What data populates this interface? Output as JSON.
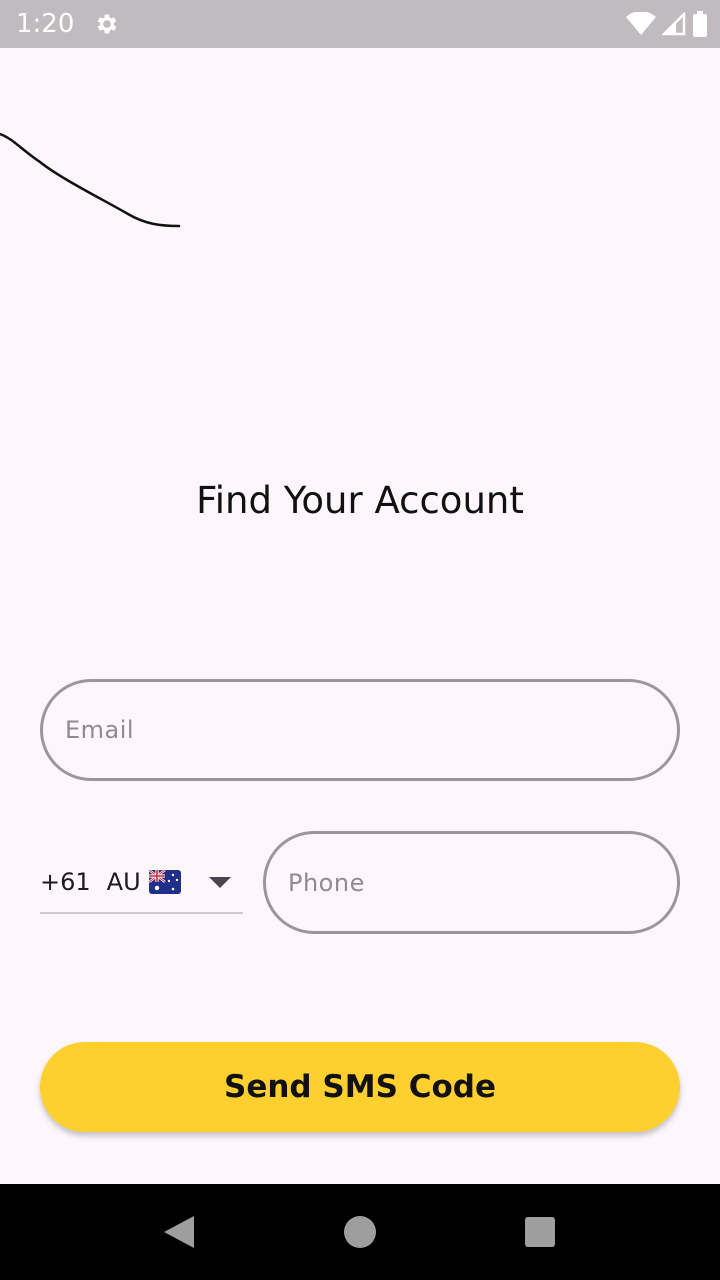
{
  "status_bar": {
    "time": "1:20",
    "icons": [
      "settings-gear-icon",
      "wifi-icon",
      "cellular-signal-icon",
      "battery-icon"
    ]
  },
  "header": {
    "title": "Find Your Account"
  },
  "form": {
    "email": {
      "value": "",
      "placeholder": "Email"
    },
    "country": {
      "dial_code": "+61",
      "iso": "AU",
      "flag_icon": "australia-flag-icon"
    },
    "phone": {
      "value": "",
      "placeholder": "Phone"
    }
  },
  "actions": {
    "send_sms_label": "Send SMS Code"
  },
  "nav_bar": {
    "icons": [
      "back-icon",
      "home-icon",
      "recents-icon"
    ]
  },
  "colors": {
    "background": "#fdf7fc",
    "accent": "#fdd02f",
    "outline": "#9a969b",
    "status_bar": "#bfbbbf"
  }
}
